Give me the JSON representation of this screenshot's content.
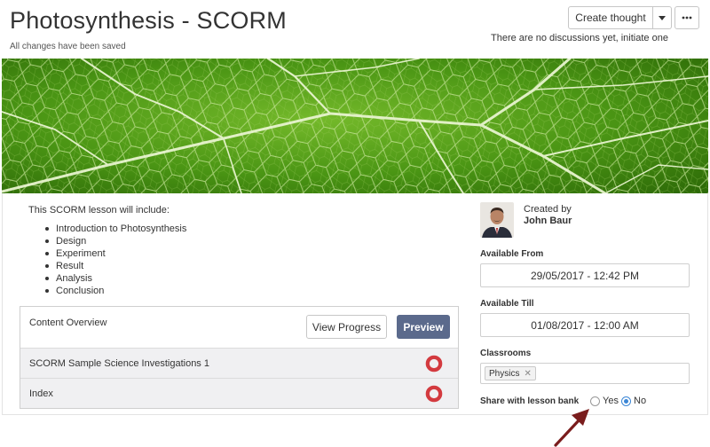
{
  "header": {
    "title": "Photosynthesis - SCORM",
    "save_status": "All changes have been saved",
    "create_thought_label": "Create thought",
    "discussions_text": "There are no discussions yet, initiate one"
  },
  "lesson": {
    "intro": "This SCORM lesson will include:",
    "topics": [
      "Introduction to Photosynthesis",
      "Design",
      "Experiment",
      "Result",
      "Analysis",
      "Conclusion"
    ]
  },
  "content_overview": {
    "title": "Content Overview",
    "view_progress_label": "View Progress",
    "preview_label": "Preview",
    "items": [
      {
        "label": "SCORM Sample Science Investigations 1"
      },
      {
        "label": "Index"
      }
    ]
  },
  "sidebar": {
    "created_by_label": "Created by",
    "author": "John Baur",
    "available_from_label": "Available From",
    "available_from_value": "29/05/2017 - 12:42 PM",
    "available_till_label": "Available Till",
    "available_till_value": "01/08/2017 - 12:00 AM",
    "classrooms_label": "Classrooms",
    "classrooms": [
      "Physics"
    ],
    "share_label": "Share with lesson bank",
    "share_options": [
      "Yes",
      "No"
    ],
    "share_selected": "No"
  },
  "icons": {
    "caret": "caret-down-icon",
    "more": "ellipsis-icon",
    "status": "status-ring-icon",
    "remove_tag": "close-icon",
    "annotation": "arrow-annotation-icon"
  },
  "colors": {
    "preview_button": "#5b6a8c",
    "status_ring": "#d33a3f",
    "radio_selected": "#3b86d6",
    "annotation_arrow": "#7a1d1d",
    "leaf_green": "#3d8a0c"
  }
}
